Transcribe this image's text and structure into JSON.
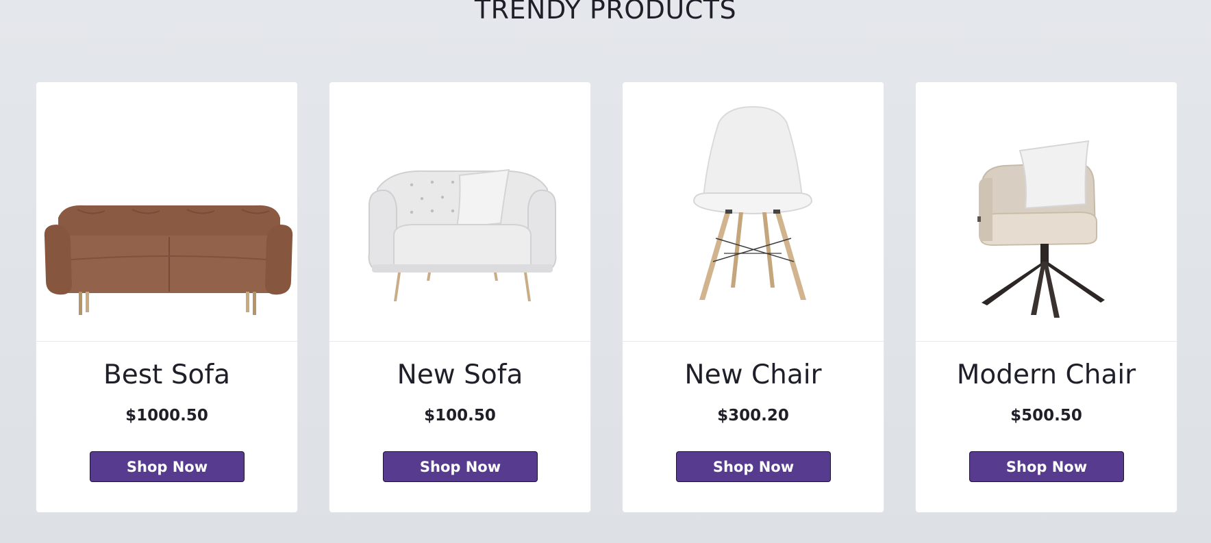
{
  "section": {
    "title": "TRENDY PRODUCTS"
  },
  "products": [
    {
      "name": "Best Sofa",
      "price": "$1000.50",
      "button_label": "Shop Now",
      "image": "brown-leather-sofa"
    },
    {
      "name": "New Sofa",
      "price": "$100.50",
      "button_label": "Shop Now",
      "image": "white-tufted-armchair"
    },
    {
      "name": "New Chair",
      "price": "$300.20",
      "button_label": "Shop Now",
      "image": "white-shell-chair"
    },
    {
      "name": "Modern Chair",
      "price": "$500.50",
      "button_label": "Shop Now",
      "image": "beige-swivel-chair"
    }
  ],
  "colors": {
    "button_background": "#573b8e",
    "page_background": "#e4e7eb",
    "card_background": "#ffffff",
    "text": "#1f1f29"
  }
}
